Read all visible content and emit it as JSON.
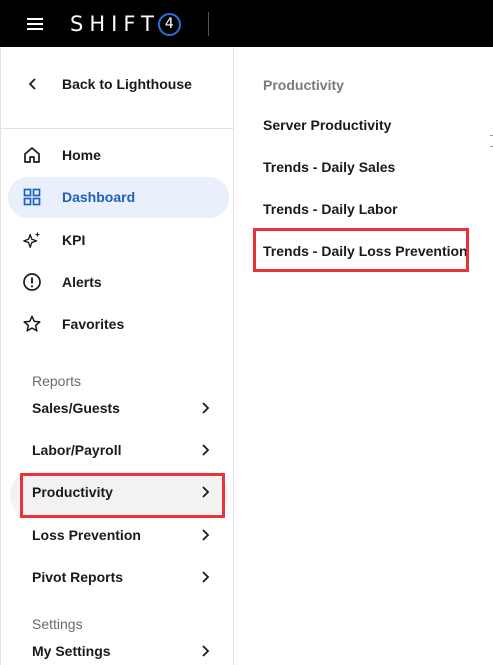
{
  "header": {
    "brand": "SHIFT",
    "brand_mark": "4"
  },
  "sidebar": {
    "back_label": "Back to Lighthouse",
    "items": [
      {
        "label": "Home",
        "icon": "home-icon"
      },
      {
        "label": "Dashboard",
        "icon": "dashboard-grid-icon",
        "active": true
      },
      {
        "label": "KPI",
        "icon": "sparkle-icon"
      },
      {
        "label": "Alerts",
        "icon": "alert-circle-icon"
      },
      {
        "label": "Favorites",
        "icon": "star-icon"
      }
    ],
    "reports_heading": "Reports",
    "reports": [
      {
        "label": "Sales/Guests"
      },
      {
        "label": "Labor/Payroll"
      },
      {
        "label": "Productivity",
        "selected": true
      },
      {
        "label": "Loss Prevention"
      },
      {
        "label": "Pivot Reports"
      }
    ],
    "settings_heading": "Settings",
    "settings": [
      {
        "label": "My Settings"
      }
    ]
  },
  "panel": {
    "title": "Productivity",
    "items": [
      {
        "label": "Server Productivity"
      },
      {
        "label": "Trends - Daily Sales"
      },
      {
        "label": "Trends - Daily Labor"
      },
      {
        "label": "Trends - Daily Loss Prevention",
        "highlighted": true
      }
    ]
  },
  "colors": {
    "topbar": "#000000",
    "accent": "#1f5fbf",
    "active_bg": "#e9f0fb",
    "highlight": "#e8333a",
    "logo_ring": "#2a6fdb"
  }
}
